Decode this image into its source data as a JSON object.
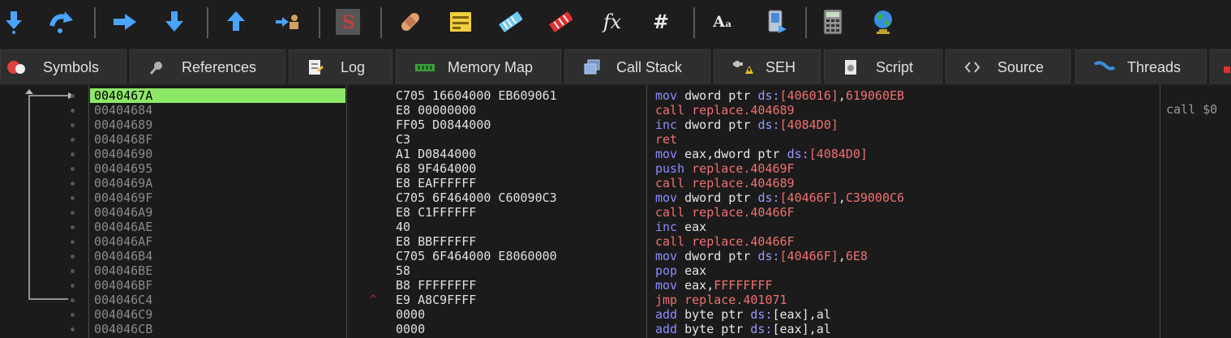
{
  "toolbar": {
    "icons": [
      "step-into-icon",
      "step-over-icon",
      "run-to-selection-icon",
      "trace-into-icon",
      "execute-till-return-icon",
      "run-to-user-code-icon",
      "scylla-icon",
      "patches-icon",
      "comments-icon",
      "labels-icon",
      "bookmarks-icon",
      "functions-icon",
      "variables-icon",
      "strings-icon",
      "device-icon",
      "calculator-icon",
      "web-globe-icon"
    ],
    "fx_label": "fx",
    "hash_label": "#",
    "font_label": "Aₐ"
  },
  "tabs": [
    {
      "label": "Symbols",
      "icon": "symbols-icon"
    },
    {
      "label": "References",
      "icon": "references-icon"
    },
    {
      "label": "Log",
      "icon": "log-icon"
    },
    {
      "label": "Memory Map",
      "icon": "memory-map-icon"
    },
    {
      "label": "Call Stack",
      "icon": "call-stack-icon"
    },
    {
      "label": "SEH",
      "icon": "seh-icon"
    },
    {
      "label": "Script",
      "icon": "script-icon"
    },
    {
      "label": "Source",
      "icon": "source-icon"
    },
    {
      "label": "Threads",
      "icon": "threads-icon"
    }
  ],
  "disassembly": {
    "selected_index": 0,
    "comment": "call $0",
    "rows": [
      {
        "addr": "0040467A",
        "bytes": "C705 16604000 EB609061",
        "mnem": "mov",
        "ptr": "dword ptr ",
        "seg": "ds:",
        "op1": "[406016]",
        "comma": ",",
        "op2": "619060EB"
      },
      {
        "addr": "00404684",
        "bytes": "E8 00000000",
        "mnem": "call",
        "op2": "replace.404689"
      },
      {
        "addr": "00404689",
        "bytes": "FF05 D0844000",
        "mnem": "inc",
        "ptr": "dword ptr ",
        "seg": "ds:",
        "op1": "[4084D0]"
      },
      {
        "addr": "0040468F",
        "bytes": "C3",
        "mnem": "ret"
      },
      {
        "addr": "00404690",
        "bytes": "A1 D0844000",
        "mnem": "mov",
        "ptr": "eax,dword ptr ",
        "seg": "ds:",
        "op1": "[4084D0]"
      },
      {
        "addr": "00404695",
        "bytes": "68 9F464000",
        "mnem": "push",
        "op2": "replace.40469F"
      },
      {
        "addr": "0040469A",
        "bytes": "E8 EAFFFFFF",
        "mnem": "call",
        "op2": "replace.404689"
      },
      {
        "addr": "0040469F",
        "bytes": "C705 6F464000 C60090C3",
        "mnem": "mov",
        "ptr": "dword ptr ",
        "seg": "ds:",
        "op1": "[40466F]",
        "comma": ",",
        "op2": "C39000C6"
      },
      {
        "addr": "004046A9",
        "bytes": "E8 C1FFFFFF",
        "mnem": "call",
        "op2": "replace.40466F"
      },
      {
        "addr": "004046AE",
        "bytes": "40",
        "mnem": "inc",
        "ptr": "eax"
      },
      {
        "addr": "004046AF",
        "bytes": "E8 BBFFFFFF",
        "mnem": "call",
        "op2": "replace.40466F"
      },
      {
        "addr": "004046B4",
        "bytes": "C705 6F464000 E8060000",
        "mnem": "mov",
        "ptr": "dword ptr ",
        "seg": "ds:",
        "op1": "[40466F]",
        "comma": ",",
        "op2": "6E8"
      },
      {
        "addr": "004046BE",
        "bytes": "58",
        "mnem": "pop",
        "ptr": "eax"
      },
      {
        "addr": "004046BF",
        "bytes": "B8 FFFFFFFF",
        "mnem": "mov",
        "ptr": "eax,",
        "op2": "FFFFFFFF"
      },
      {
        "addr": "004046C4",
        "bytes": "E9 A8C9FFFF",
        "mark": "^",
        "mnem": "jmp",
        "op2": "replace.401071"
      },
      {
        "addr": "004046C9",
        "bytes": "0000",
        "mnem": "add",
        "ptr": "byte ptr ",
        "seg": "ds:",
        "op1": "[eax]",
        "comma": ",",
        "op2b": "al"
      },
      {
        "addr": "004046CB",
        "bytes": "0000",
        "mnem": "add",
        "ptr": "byte ptr ",
        "seg": "ds:",
        "op1": "[eax]",
        "comma": ",",
        "op2b": "al"
      }
    ]
  },
  "colors": {
    "selection": "#8ee868",
    "mnemonic_call": "#f07070",
    "mnemonic_normal": "#8c8cff",
    "value": "#f07070"
  }
}
